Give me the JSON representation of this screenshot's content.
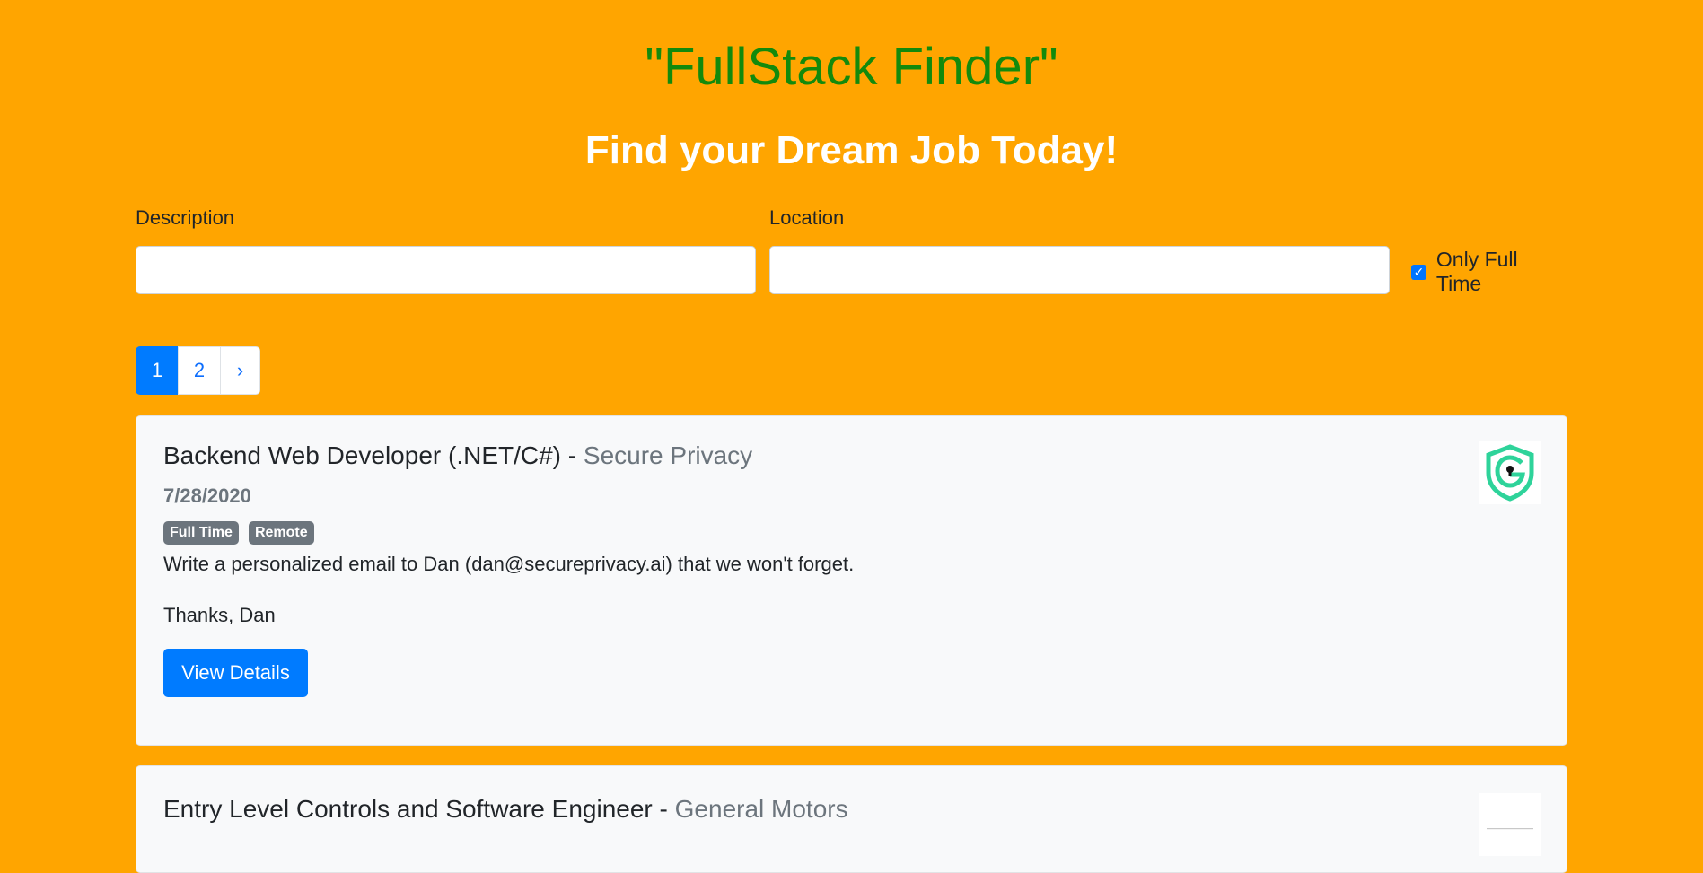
{
  "header": {
    "app_title": "\"FullStack Finder\"",
    "subtitle": "Find your Dream Job Today!"
  },
  "search": {
    "description_label": "Description",
    "description_value": "",
    "location_label": "Location",
    "location_value": "",
    "full_time_label": "Only Full Time",
    "full_time_checked": true
  },
  "pagination": {
    "pages": [
      "1",
      "2"
    ],
    "next": "›",
    "current": "1"
  },
  "jobs": [
    {
      "title": "Backend Web Developer (.NET/C#)",
      "separator": "-",
      "company": "Secure Privacy",
      "date": "7/28/2020",
      "badges": [
        "Full Time",
        "Remote"
      ],
      "description": "Write a personalized email to Dan (dan@secureprivacy.ai) that we won't forget.",
      "signoff": "Thanks, Dan",
      "button_label": "View Details",
      "logo_icon": "shield-keyhole-icon",
      "logo_color": "#2ed39a"
    },
    {
      "title": "Entry Level Controls and Software Engineer",
      "separator": "-",
      "company": "General Motors",
      "logo_icon": "general-motors-logo-icon"
    }
  ],
  "colors": {
    "background": "#FFA500",
    "title": "#138a0c",
    "primary": "#007bff",
    "badge": "#6c757d",
    "card": "#f8f9fa"
  }
}
